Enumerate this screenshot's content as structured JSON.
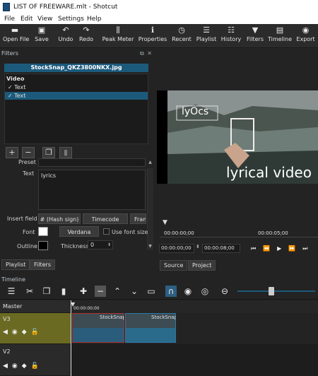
{
  "window": {
    "title": "LIST OF FREEWARE.mlt - Shotcut"
  },
  "menu": [
    "File",
    "Edit",
    "View",
    "Settings",
    "Help"
  ],
  "toolbar": [
    {
      "icon": "folder-open-icon",
      "label": "Open File"
    },
    {
      "icon": "save-icon",
      "label": "Save"
    },
    {
      "icon": "undo-icon",
      "label": "Undo"
    },
    {
      "icon": "redo-icon",
      "label": "Redo"
    },
    {
      "icon": "peak-meter-icon",
      "label": "Peak Meter"
    },
    {
      "icon": "properties-icon",
      "label": "Properties"
    },
    {
      "icon": "clock-icon",
      "label": "Recent"
    },
    {
      "icon": "list-icon",
      "label": "Playlist"
    },
    {
      "icon": "history-icon",
      "label": "History"
    },
    {
      "icon": "filter-icon",
      "label": "Filters"
    },
    {
      "icon": "timeline-icon",
      "label": "Timeline"
    },
    {
      "icon": "export-icon",
      "label": "Export"
    }
  ],
  "filters": {
    "title": "Filters",
    "clip_name": "StockSnap_QKZ3800NKX.jpg",
    "group": "Video",
    "items": [
      {
        "label": "Text",
        "checked": true,
        "selected": false
      },
      {
        "label": "Text",
        "checked": true,
        "selected": true
      }
    ],
    "preset_label": "Preset",
    "text_label": "Text",
    "text_value": "lyrics",
    "insert_field_label": "Insert field",
    "hash_sign": "# (Hash sign)",
    "timecode": "Timecode",
    "frame": "Fram",
    "font_label": "Font",
    "font_name": "Verdana",
    "use_font_size": "Use font size",
    "outline_label": "Outline",
    "thickness_label": "Thickness",
    "thickness_value": "0"
  },
  "left_tabs": [
    "Playlist",
    "Filters"
  ],
  "player": {
    "overlay_text_small": "lyOcs",
    "overlay_text_large": "lyrical video",
    "ruler": [
      "00:00:00;00",
      "00:00:05;00"
    ],
    "current_time": "00:00:00;00",
    "total_time": "00:00:08;00",
    "tabs": [
      "Source",
      "Project"
    ]
  },
  "timeline": {
    "title": "Timeline",
    "master": "Master",
    "ruler_start": "00:00:00;00",
    "tracks": [
      {
        "name": "V3",
        "clips": [
          "StockSnap",
          "StockSnap"
        ]
      },
      {
        "name": "V2",
        "clips": []
      }
    ]
  }
}
